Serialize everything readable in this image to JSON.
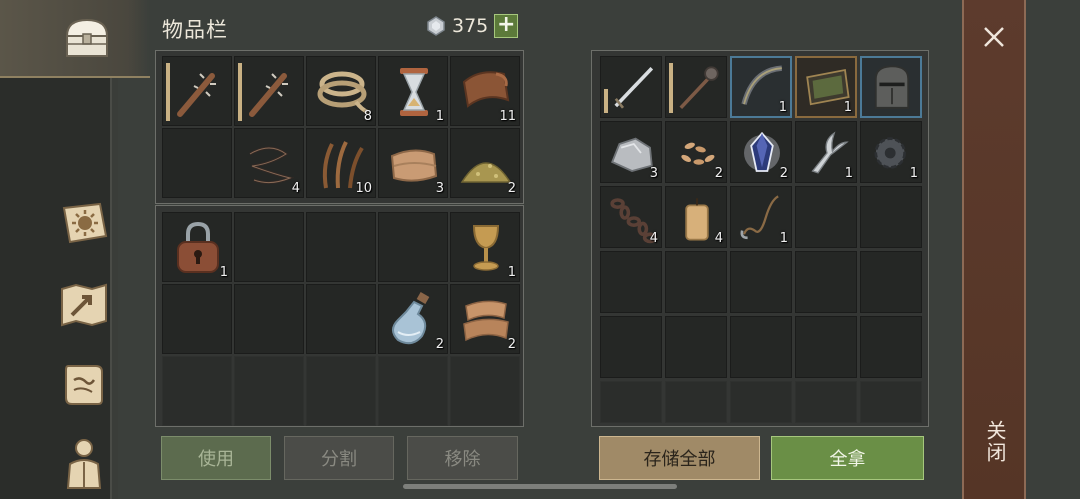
{
  "header": {
    "title": "物品栏",
    "currency_amount": "375",
    "plus_label": "+"
  },
  "nav": {
    "items": [
      {
        "name": "storage-chest",
        "icon": "chest-icon"
      },
      {
        "name": "skills",
        "icon": "sun-book-icon"
      },
      {
        "name": "map",
        "icon": "map-icon"
      },
      {
        "name": "recipes",
        "icon": "scroll-icon"
      },
      {
        "name": "character",
        "icon": "character-icon"
      }
    ]
  },
  "inventory": {
    "row1": [
      {
        "icon": "spiked-club-icon",
        "count": ""
      },
      {
        "icon": "spiked-club-icon",
        "count": ""
      },
      {
        "icon": "rope-icon",
        "count": "8"
      },
      {
        "icon": "hourglass-icon",
        "count": "1"
      },
      {
        "icon": "leather-icon",
        "count": "11"
      }
    ],
    "row2": [
      {
        "icon": "",
        "count": ""
      },
      {
        "icon": "wire-icon",
        "count": "4"
      },
      {
        "icon": "plant-fiber-icon",
        "count": "10"
      },
      {
        "icon": "cloth-icon",
        "count": "3"
      },
      {
        "icon": "powder-icon",
        "count": "2"
      }
    ],
    "row3": [
      {
        "icon": "padlock-icon",
        "count": "1"
      },
      {
        "icon": "",
        "count": ""
      },
      {
        "icon": "",
        "count": ""
      },
      {
        "icon": "",
        "count": ""
      },
      {
        "icon": "goblet-icon",
        "count": "1"
      }
    ],
    "row4": [
      {
        "icon": "",
        "count": ""
      },
      {
        "icon": "",
        "count": ""
      },
      {
        "icon": "",
        "count": ""
      },
      {
        "icon": "potion-bottle-icon",
        "count": "2"
      },
      {
        "icon": "fabric-scraps-icon",
        "count": "2"
      }
    ]
  },
  "storage": {
    "row1": [
      {
        "icon": "sword-icon",
        "count": ""
      },
      {
        "icon": "mace-icon",
        "count": ""
      },
      {
        "icon": "bow-icon",
        "count": "1"
      },
      {
        "icon": "tablet-icon",
        "count": "1"
      },
      {
        "icon": "knight-helmet-icon",
        "count": ""
      }
    ],
    "row2": [
      {
        "icon": "ore-icon",
        "count": "3"
      },
      {
        "icon": "seeds-icon",
        "count": "2"
      },
      {
        "icon": "crystal-icon",
        "count": "2"
      },
      {
        "icon": "forked-blade-icon",
        "count": "1"
      },
      {
        "icon": "gear-icon",
        "count": "1"
      }
    ],
    "row3": [
      {
        "icon": "chain-icon",
        "count": "4"
      },
      {
        "icon": "candle-icon",
        "count": "4"
      },
      {
        "icon": "hook-rope-icon",
        "count": "1"
      },
      {
        "icon": "",
        "count": ""
      },
      {
        "icon": "",
        "count": ""
      }
    ]
  },
  "buttons": {
    "use": "使用",
    "split": "分割",
    "remove": "移除",
    "store_all": "存储全部",
    "take_all": "全拿"
  },
  "close": {
    "label": "关闭"
  },
  "colors": {
    "accent_green": "#6a8f46",
    "accent_tan": "#a08a67",
    "close_panel": "#553526"
  }
}
